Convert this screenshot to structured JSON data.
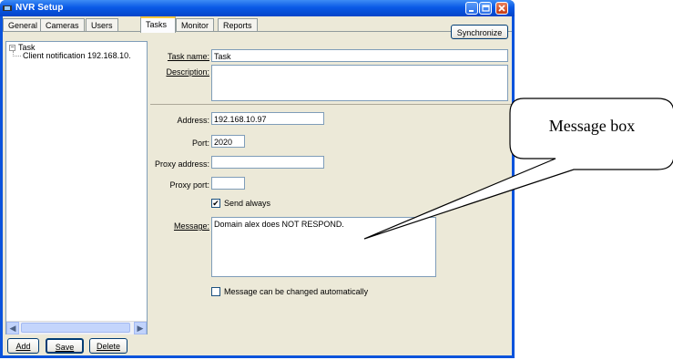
{
  "window": {
    "title": "NVR Setup"
  },
  "tabs": [
    {
      "label": "General"
    },
    {
      "label": "Cameras"
    },
    {
      "label": "Users"
    },
    {
      "label": "Tasks"
    },
    {
      "label": "Monitor"
    },
    {
      "label": "Reports"
    }
  ],
  "synchronize_label": "Synchronize",
  "tree": {
    "root": "Task",
    "child": "Client notification 192.168.10."
  },
  "task_buttons": {
    "add": "Add",
    "save": "Save",
    "delete": "Delete"
  },
  "task_form": {
    "task_name_label": "Task name:",
    "task_name_value": "Task",
    "description_label": "Description:",
    "description_value": ""
  },
  "action_form": {
    "address_label": "Address:",
    "address_value": "192.168.10.97",
    "port_label": "Port:",
    "port_value": "2020",
    "proxy_address_label": "Proxy address:",
    "proxy_address_value": "",
    "proxy_port_label": "Proxy port:",
    "proxy_port_value": "",
    "send_always_label": "Send always",
    "send_always_checked": true,
    "message_label": "Message:",
    "message_value": "Domain alex does NOT RESPOND.",
    "auto_change_label": "Message can be changed automatically",
    "auto_change_checked": false
  },
  "callout": {
    "text": "Message box"
  }
}
